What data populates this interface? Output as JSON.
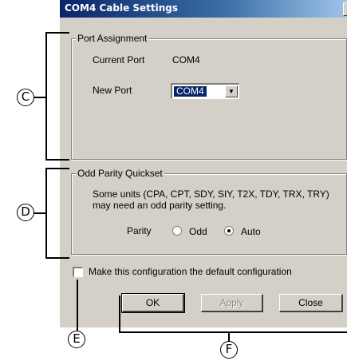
{
  "window": {
    "title": "COM4 Cable Settings",
    "close_glyph": "x"
  },
  "port_assignment": {
    "legend": "Port Assignment",
    "current_port_label": "Current Port",
    "current_port_value": "COM4",
    "new_port_label": "New Port",
    "new_port_selected": "COM4"
  },
  "odd_parity": {
    "legend": "Odd Parity Quickset",
    "description": "Some units (CPA, CPT, SDY, SIY, T2X, TDY, TRX, TRY) may need an odd parity setting.",
    "parity_label": "Parity",
    "option_odd": "Odd",
    "option_auto": "Auto",
    "selected": "Auto"
  },
  "default_config": {
    "label": "Make this configuration the default configuration",
    "checked": false
  },
  "buttons": {
    "ok": "OK",
    "apply": "Apply",
    "close": "Close"
  },
  "callouts": {
    "c": "C",
    "d": "D",
    "e": "E",
    "f": "F"
  },
  "colors": {
    "dialog_bg": "#d4d0c8",
    "titlebar_start": "#0a246a",
    "titlebar_end": "#a6caf0",
    "selection": "#0a246a"
  }
}
